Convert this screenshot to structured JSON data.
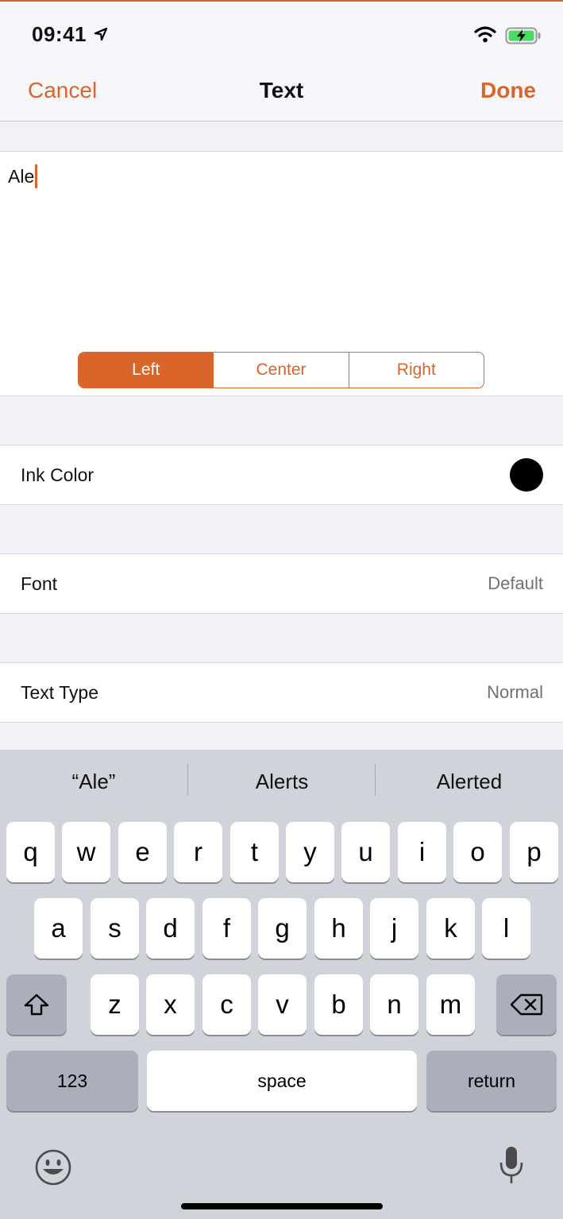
{
  "status": {
    "time": "09:41"
  },
  "nav": {
    "cancel": "Cancel",
    "title": "Text",
    "done": "Done"
  },
  "editor": {
    "typed_text": "Ale"
  },
  "alignment": {
    "options": [
      "Left",
      "Center",
      "Right"
    ],
    "selected": "Left"
  },
  "rows": {
    "ink_color": {
      "label": "Ink Color",
      "swatch_color": "#000000"
    },
    "font": {
      "label": "Font",
      "value": "Default"
    },
    "text_type": {
      "label": "Text Type",
      "value": "Normal"
    }
  },
  "keyboard": {
    "suggestions": [
      "“Ale”",
      "Alerts",
      "Alerted"
    ],
    "row1": [
      "q",
      "w",
      "e",
      "r",
      "t",
      "y",
      "u",
      "i",
      "o",
      "p"
    ],
    "row2": [
      "a",
      "s",
      "d",
      "f",
      "g",
      "h",
      "j",
      "k",
      "l"
    ],
    "row3": [
      "z",
      "x",
      "c",
      "v",
      "b",
      "n",
      "m"
    ],
    "numbers_label": "123",
    "space_label": "space",
    "return_label": "return"
  },
  "colors": {
    "accent": "#d9652a",
    "keyboard_bg": "#d1d3da",
    "key_dark": "#abafbb"
  }
}
